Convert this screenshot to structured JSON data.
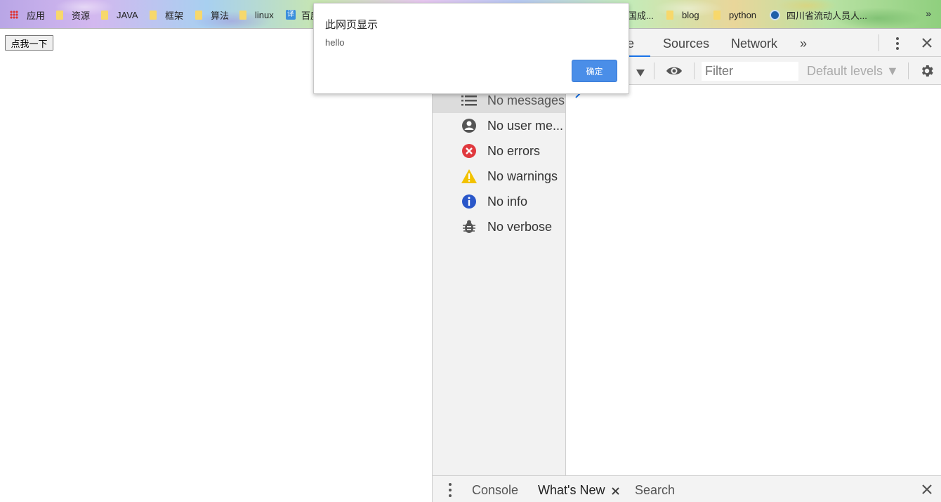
{
  "bookmarks": {
    "apps": "应用",
    "items": [
      "资源",
      "JAVA",
      "框架",
      "算法",
      "linux",
      "百度",
      "国成...",
      "blog",
      "python",
      "四川省流动人员人..."
    ],
    "more": "»"
  },
  "page": {
    "button_label": "点我一下"
  },
  "alert": {
    "title": "此网页显示",
    "message": "hello",
    "ok_label": "确定"
  },
  "devtools": {
    "tabs": [
      "le",
      "Sources",
      "Network",
      "»"
    ],
    "toolbar": {
      "filter_placeholder": "Filter",
      "levels_label": "Default levels ▼"
    },
    "sidebar": [
      {
        "label": "No messages",
        "icon": "list-icon"
      },
      {
        "label": "No user me...",
        "icon": "user-icon"
      },
      {
        "label": "No errors",
        "icon": "error-icon"
      },
      {
        "label": "No warnings",
        "icon": "warning-icon"
      },
      {
        "label": "No info",
        "icon": "info-icon"
      },
      {
        "label": "No verbose",
        "icon": "bug-icon"
      }
    ],
    "drawer": {
      "tabs": [
        "Console",
        "What's New",
        "Search"
      ]
    },
    "colors": {
      "accent": "#1a73e8",
      "error": "#e0393e",
      "warning": "#f2c200",
      "info": "#2a57c9"
    }
  }
}
